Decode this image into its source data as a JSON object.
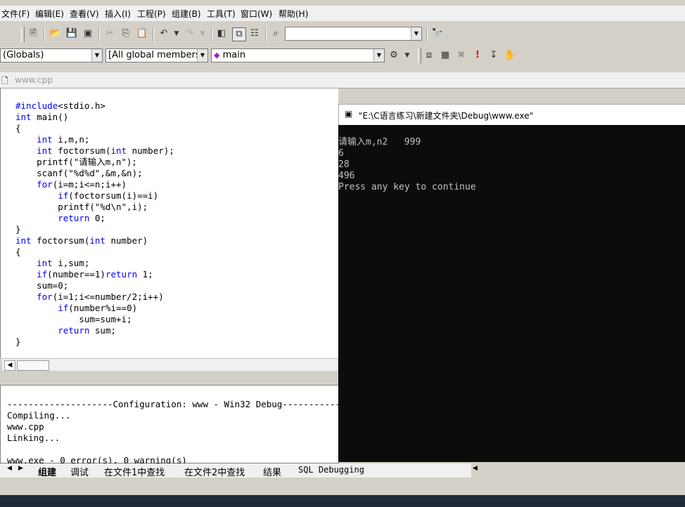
{
  "menu": [
    "文件(F)",
    "编辑(E)",
    "查看(V)",
    "插入(I)",
    "工程(P)",
    "组建(B)",
    "工具(T)",
    "窗口(W)",
    "帮助(H)"
  ],
  "toolbar": {
    "find_combo_value": "",
    "scope_combo": "(Globals)",
    "members_combo": "[All global members",
    "function_combo": "main"
  },
  "doc_tab": "www.cpp",
  "code_lines": [
    "#include<stdio.h>",
    "int main()",
    "{",
    "    int i,m,n;",
    "    int foctorsum(int number);",
    "    printf(\"请输入m,n\");",
    "    scanf(\"%d%d\",&m,&n);",
    "    for(i=m;i<=n;i++)",
    "        if(foctorsum(i)==i)",
    "        printf(\"%d\\n\",i);",
    "        return 0;",
    "}",
    "int foctorsum(int number)",
    "{",
    "    int i,sum;",
    "    if(number==1)return 1;",
    "    sum=0;",
    "    for(i=1;i<=number/2;i++)",
    "        if(number%i==0)",
    "            sum=sum+i;",
    "        return sum;",
    "}"
  ],
  "build_output": [
    "--------------------Configuration: www - Win32 Debug--------------------",
    "Compiling...",
    "www.cpp",
    "Linking...",
    "",
    "www.exe - 0 error(s), 0 warning(s)"
  ],
  "build_tabs": [
    "组建",
    "调试",
    "在文件1中查找",
    "在文件2中查找",
    "结果",
    "SQL Debugging"
  ],
  "console": {
    "title": "\"E:\\C语言练习\\新建文件夹\\Debug\\www.exe\"",
    "lines": [
      "请输入m,n2   999",
      "6",
      "28",
      "496",
      "Press any key to continue"
    ]
  }
}
